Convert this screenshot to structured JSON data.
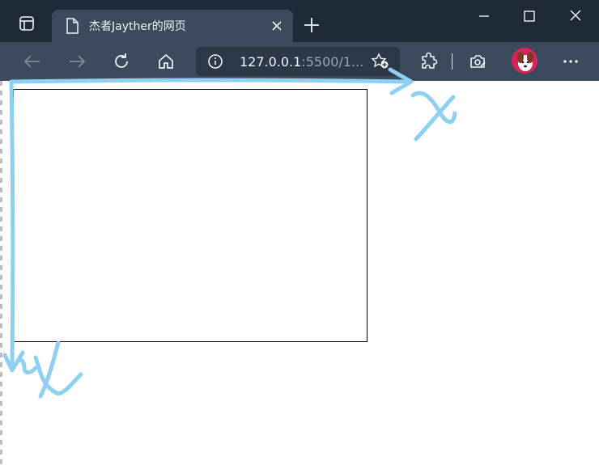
{
  "browser": {
    "tab": {
      "title": "杰者Jayther的网页"
    },
    "address_bar": {
      "host": "127.0.0.1",
      "rest": ":5500/1..."
    }
  },
  "annotations": {
    "x_axis_label": "x",
    "y_axis_label": "y",
    "stroke_color": "#8fd0f2"
  },
  "colors": {
    "tabbar_bg": "#1f2a38",
    "toolbar_bg": "#3b4a5c",
    "canvas_border": "#000000"
  }
}
